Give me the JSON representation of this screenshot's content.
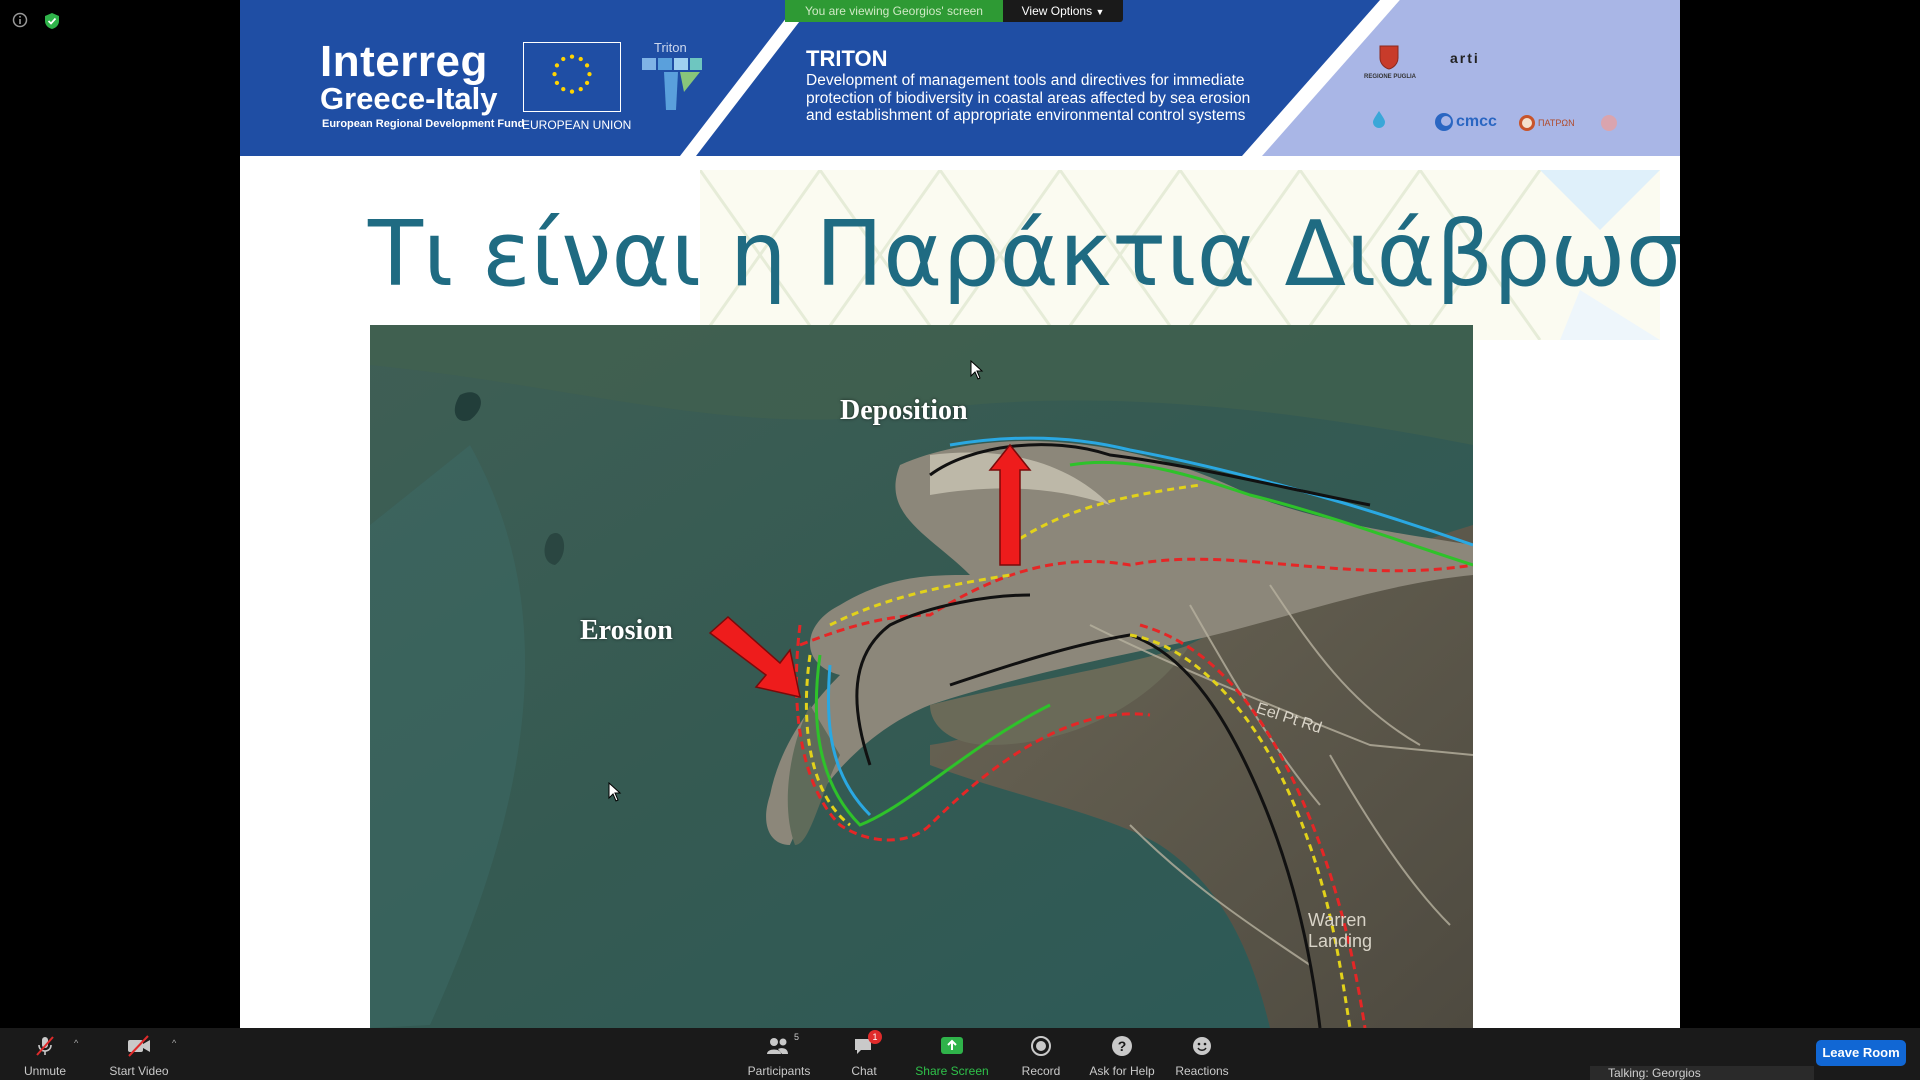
{
  "share_banner": {
    "viewing_text": "You are viewing Georgios' screen",
    "view_options": "View Options"
  },
  "slide_header": {
    "program_title": "Interreg",
    "program_subtitle": "Greece-Italy",
    "program_fund": "European Regional Development Fund",
    "eu_label": "EUROPEAN UNION",
    "project_logo_text": "Triton",
    "project_name": "TRITON",
    "project_description": "Development of management tools and directives for immediate protection of biodiversity in coastal areas affected by sea erosion and establishment of appropriate environmental control systems",
    "partner_logos": [
      "REGIONE PUGLIA",
      "arti",
      "cmcc",
      "ΠΑΤΡΩΝ"
    ]
  },
  "slide": {
    "title": "Τι είναι η Παράκτια Διάβρωση;",
    "map_labels": {
      "deposition": "Deposition",
      "erosion": "Erosion",
      "road_1": "Eel Pt Rd",
      "place_1": "Warren",
      "place_2": "Landing"
    }
  },
  "toolbar": {
    "unmute": "Unmute",
    "start_video": "Start Video",
    "participants": "Participants",
    "participants_count": "5",
    "chat": "Chat",
    "chat_badge": "1",
    "share_screen": "Share Screen",
    "record": "Record",
    "ask_for_help": "Ask for Help",
    "reactions": "Reactions",
    "leave_room": "Leave Room",
    "talking": "Talking: Georgios"
  },
  "colors": {
    "banner_blue": "#1f4ea4",
    "title_teal": "#1f6b82",
    "share_green": "#2e9a34",
    "leave_blue": "#1167d4"
  }
}
